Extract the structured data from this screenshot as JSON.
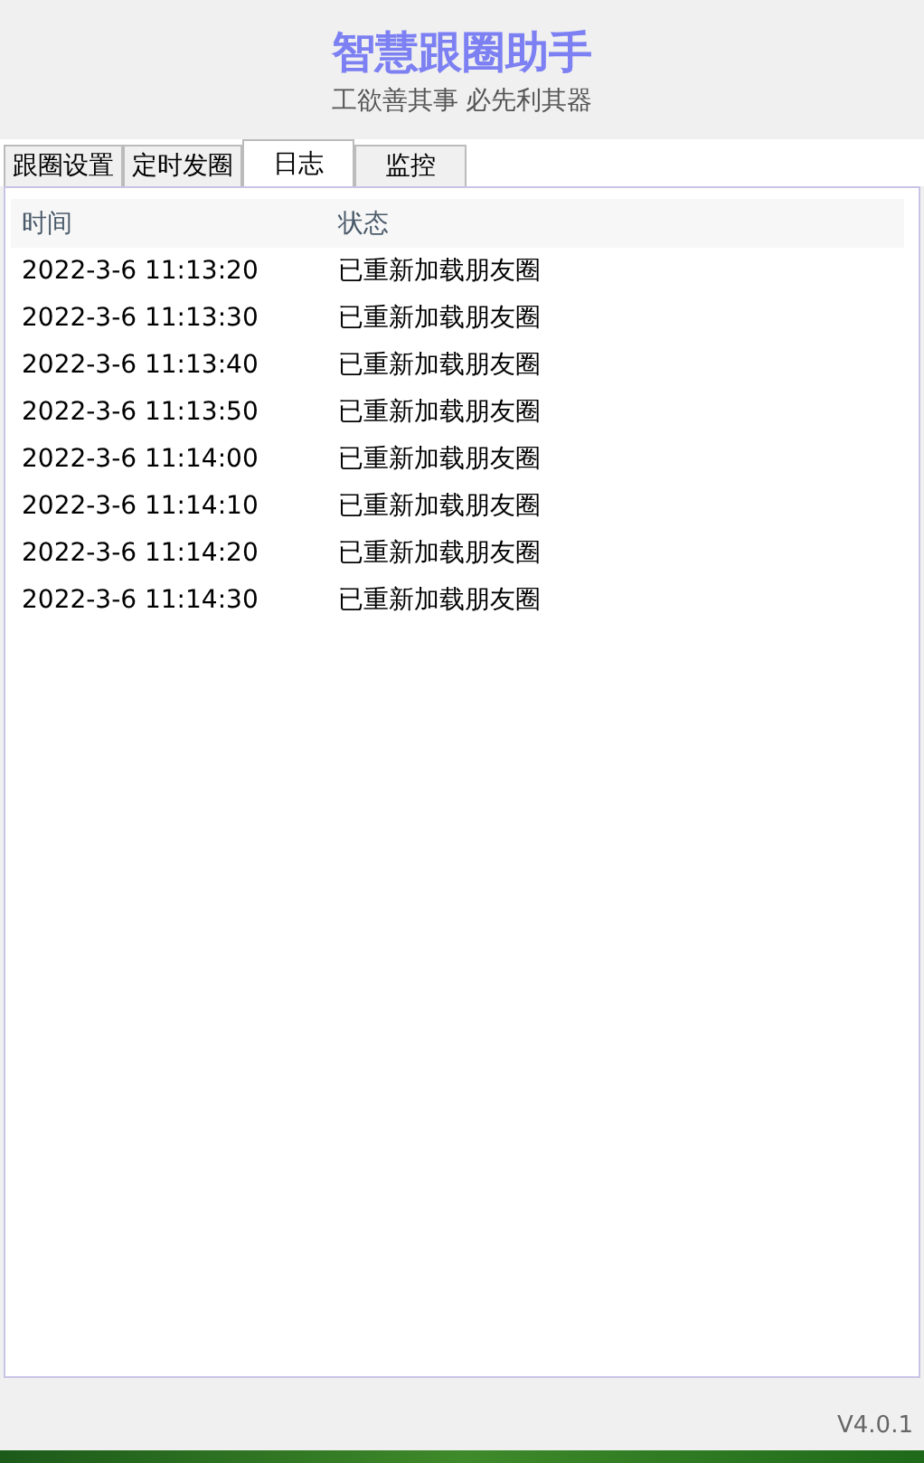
{
  "header": {
    "title": "智慧跟圈助手",
    "subtitle": "工欲善其事 必先利其器"
  },
  "tabs": [
    {
      "label": "跟圈设置",
      "selected": false
    },
    {
      "label": "定时发圈",
      "selected": false
    },
    {
      "label": "日志",
      "selected": true
    },
    {
      "label": "监控",
      "selected": false
    }
  ],
  "log_table": {
    "columns": [
      "时间",
      "状态"
    ],
    "rows": [
      [
        "2022-3-6 11:13:20",
        "已重新加载朋友圈"
      ],
      [
        "2022-3-6 11:13:30",
        "已重新加载朋友圈"
      ],
      [
        "2022-3-6 11:13:40",
        "已重新加载朋友圈"
      ],
      [
        "2022-3-6 11:13:50",
        "已重新加载朋友圈"
      ],
      [
        "2022-3-6 11:14:00",
        "已重新加载朋友圈"
      ],
      [
        "2022-3-6 11:14:10",
        "已重新加载朋友圈"
      ],
      [
        "2022-3-6 11:14:20",
        "已重新加载朋友圈"
      ],
      [
        "2022-3-6 11:14:30",
        "已重新加载朋友圈"
      ]
    ]
  },
  "status_bar": {
    "version": "V4.0.1"
  }
}
